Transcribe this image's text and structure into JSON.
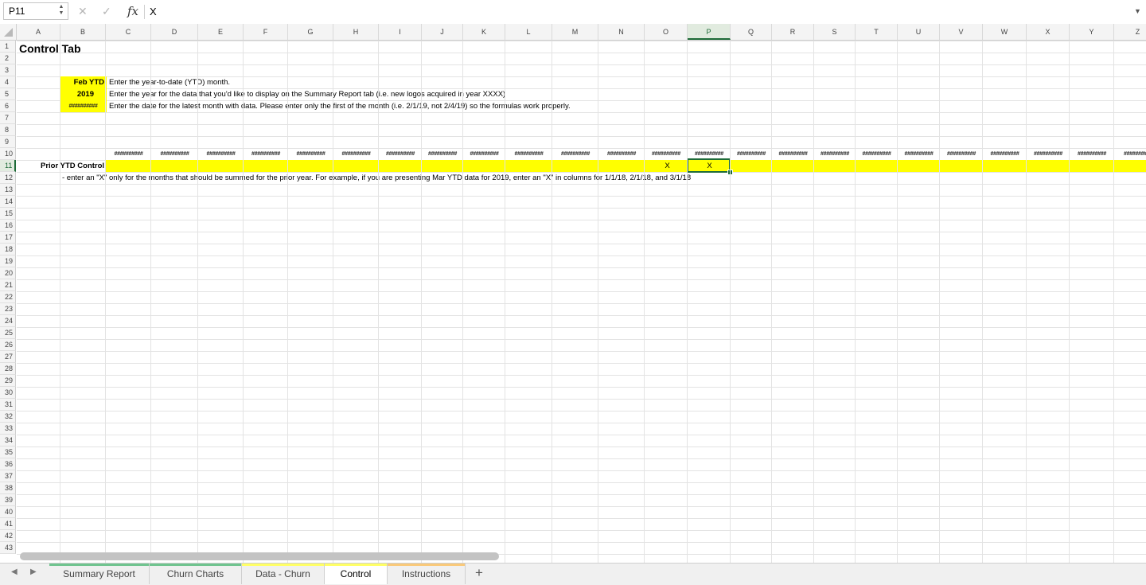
{
  "formula_bar": {
    "name_box": "P11",
    "content": "X"
  },
  "columns": [
    "A",
    "B",
    "C",
    "D",
    "E",
    "F",
    "G",
    "H",
    "I",
    "J",
    "K",
    "L",
    "M",
    "N",
    "O",
    "P",
    "Q",
    "R",
    "S",
    "T",
    "U",
    "V",
    "W",
    "X",
    "Y",
    "Z"
  ],
  "selected_column": "P",
  "rows": [
    "1",
    "2",
    "3",
    "4",
    "5",
    "6",
    "7",
    "8",
    "9",
    "10",
    "11",
    "12",
    "13",
    "14",
    "15",
    "16",
    "17",
    "18",
    "19",
    "20",
    "21",
    "22",
    "23",
    "24",
    "25",
    "26",
    "27",
    "28",
    "29",
    "30",
    "31",
    "32",
    "33",
    "34",
    "35",
    "36",
    "37",
    "38",
    "39",
    "40",
    "41",
    "42",
    "43"
  ],
  "selected_row": "11",
  "cells": {
    "title": "Control Tab",
    "ytd_month": "Feb YTD",
    "ytd_month_desc": "Enter the year-to-date (YTD) month.",
    "year": "2019",
    "year_desc": "Enter the year for the data that you'd like to display on the Summary Report tab (i.e. new logos acquired in year XXXX)",
    "latest_date": "##########",
    "latest_date_desc": "Enter the date for the latest month with data.  Please enter only the first of the month (i.e. 2/1/19, not 2/4/19) so the formulas work properly.",
    "row10_hash": "##########",
    "prior_ytd_label": "Prior YTD Control",
    "mark_o": "X",
    "mark_p": "X",
    "prior_ytd_note": "- enter an \"X\" only for the months that should be summed for the prior year.  For example, if you are presenting Mar YTD data for 2019, enter an \"X\" in columns for 1/1/18, 2/1/18, and 3/1/18"
  },
  "sheet_tabs": [
    {
      "label": "Summary Report",
      "color": "#70c48f"
    },
    {
      "label": "Churn Charts",
      "color": "#70c48f"
    },
    {
      "label": "Data - Churn",
      "color": "#ffff66"
    },
    {
      "label": "Control",
      "color": "#ffff66",
      "active": true
    },
    {
      "label": "Instructions",
      "color": "#f9c97a"
    }
  ],
  "colors": {
    "highlight": "#ffff00",
    "selection": "#1e6b38"
  }
}
